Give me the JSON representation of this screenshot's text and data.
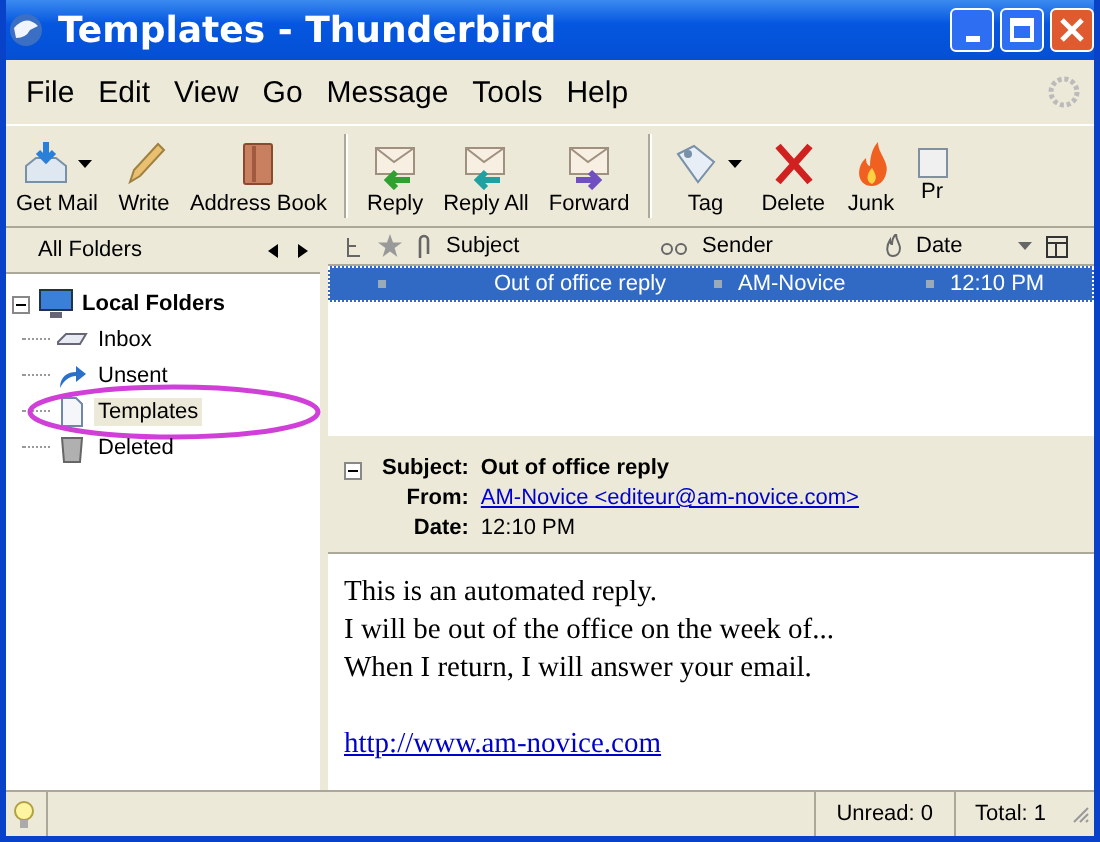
{
  "window": {
    "title": "Templates - Thunderbird"
  },
  "menu": [
    "File",
    "Edit",
    "View",
    "Go",
    "Message",
    "Tools",
    "Help"
  ],
  "toolbar": [
    [
      {
        "label": "Get Mail",
        "dropdown": true
      },
      {
        "label": "Write",
        "dropdown": false
      },
      {
        "label": "Address Book",
        "dropdown": false
      }
    ],
    [
      {
        "label": "Reply",
        "dropdown": false
      },
      {
        "label": "Reply All",
        "dropdown": false
      },
      {
        "label": "Forward",
        "dropdown": false
      }
    ],
    [
      {
        "label": "Tag",
        "dropdown": true
      },
      {
        "label": "Delete",
        "dropdown": false
      },
      {
        "label": "Junk",
        "dropdown": false
      },
      {
        "label": "Pr",
        "dropdown": false
      }
    ]
  ],
  "folder_pane": {
    "title": "All Folders",
    "account": {
      "name": "Local Folders",
      "expanded": true,
      "children": [
        {
          "name": "Inbox",
          "selected": false
        },
        {
          "name": "Unsent",
          "selected": false
        },
        {
          "name": "Templates",
          "selected": true
        },
        {
          "name": "Deleted",
          "selected": false
        }
      ]
    }
  },
  "thread_pane": {
    "columns": [
      "Subject",
      "Sender",
      "Date"
    ],
    "rows": [
      {
        "subject": "Out of office reply",
        "sender": "AM-Novice",
        "date": "12:10 PM",
        "selected": true
      }
    ]
  },
  "message_header": {
    "expanded": true,
    "fields": [
      {
        "label": "Subject:",
        "value": "Out of office reply",
        "kind": "bold"
      },
      {
        "label": "From:",
        "value": "AM-Novice <editeur@am-novice.com>",
        "kind": "link"
      },
      {
        "label": "Date:",
        "value": "12:10 PM",
        "kind": "plain"
      }
    ]
  },
  "message_body": [
    {
      "text": "This is an automated reply.",
      "kind": "text"
    },
    {
      "text": "I will be out of the office on the week of...",
      "kind": "text"
    },
    {
      "text": "When I return, I will answer your email.",
      "kind": "text"
    },
    {
      "kind": "blank"
    },
    {
      "text": "http://www.am-novice.com",
      "kind": "link"
    }
  ],
  "status_bar": {
    "unread": "Unread: 0",
    "total": "Total: 1"
  }
}
